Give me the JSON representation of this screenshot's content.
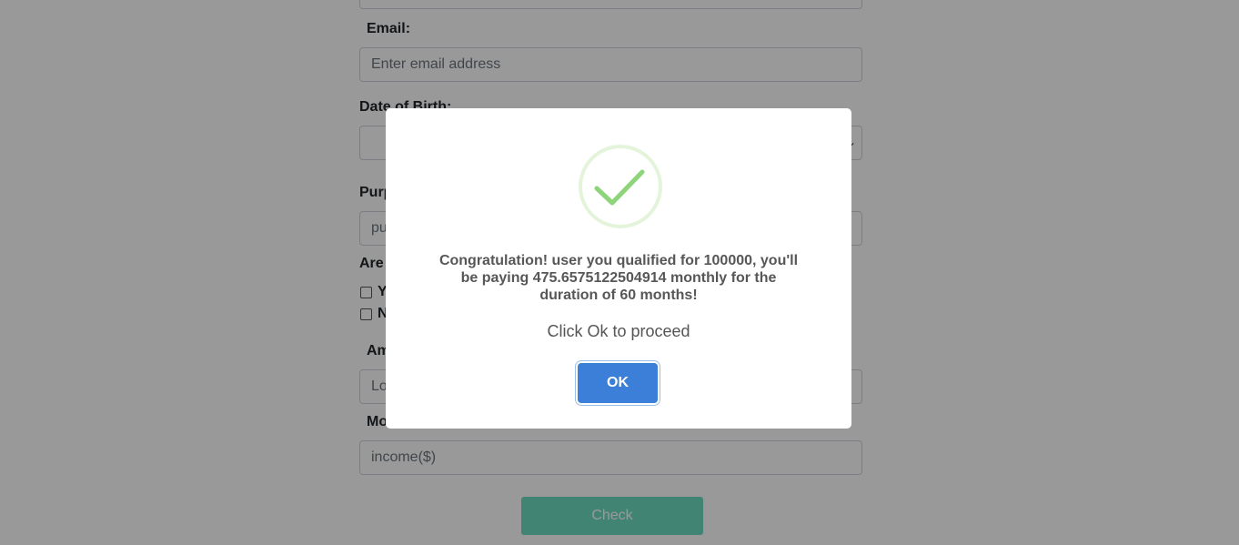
{
  "form": {
    "email_label": "Email:",
    "email_placeholder": "Enter email address",
    "dob_label": "Date of Birth:",
    "purpose_label_partial": "Purp",
    "purpose_placeholder_partial": "pu",
    "question_label_partial": "Are",
    "option_yes_partial": "Y",
    "option_no_partial": "N",
    "amount_label_partial": "Am",
    "amount_placeholder_partial": "Lo",
    "income_label_partial": "Mo",
    "income_placeholder": "income($)",
    "check_button": "Check"
  },
  "modal": {
    "icon": "success-checkmark",
    "message": "Congratulation! user you qualified for 100000, you'll be paying 475.6575122504914 monthly for the duration of 60 months!",
    "subtext": "Click Ok to proceed",
    "ok_button": "OK"
  },
  "colors": {
    "ok_button": "#3c7fd8",
    "check_button": "#6fdcc2",
    "success_green": "#a5dc86"
  }
}
